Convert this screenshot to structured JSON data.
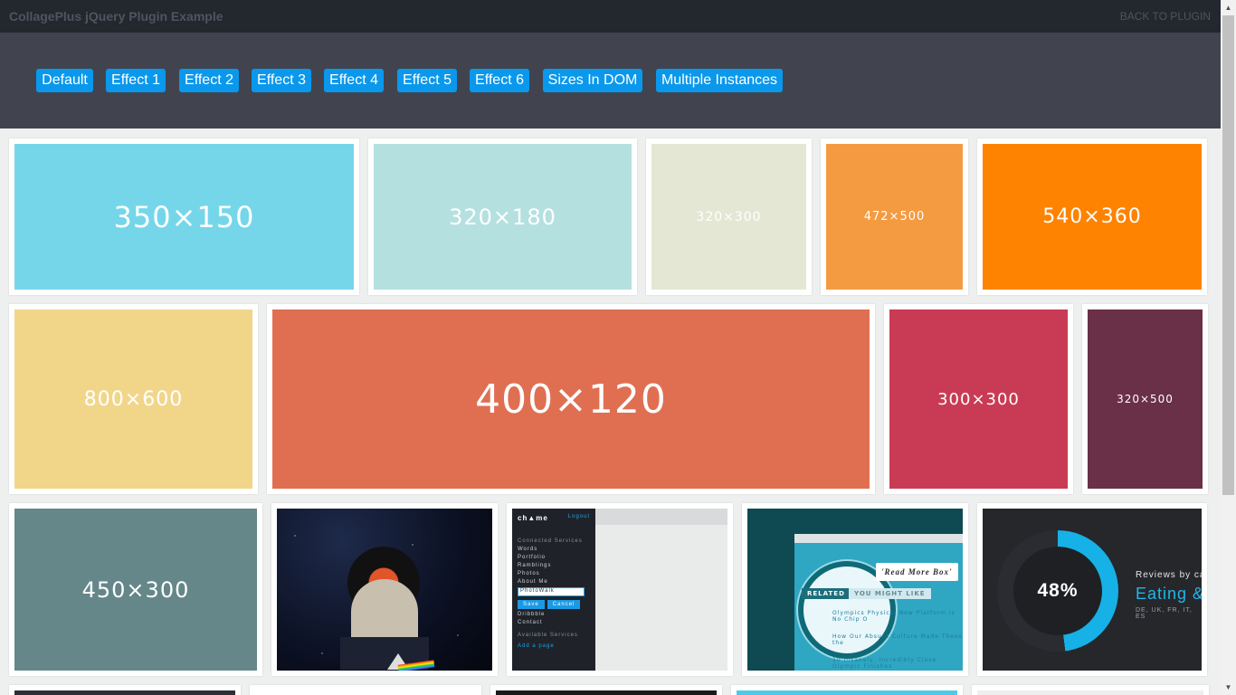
{
  "header": {
    "title": "CollagePlus jQuery Plugin Example",
    "back_link": "BACK TO PLUGIN"
  },
  "toolbar": {
    "buttons": [
      "Default",
      "Effect 1",
      "Effect 2",
      "Effect 3",
      "Effect 4",
      "Effect 5",
      "Effect 6",
      "Sizes In DOM",
      "Multiple Instances"
    ]
  },
  "placeholders": [
    {
      "label": "350×150",
      "color": "#75d6ea"
    },
    {
      "label": "320×180",
      "color": "#b5e0e0"
    },
    {
      "label": "320×300",
      "color": "#e4e7d3"
    },
    {
      "label": "472×500",
      "color": "#f49b41"
    },
    {
      "label": "540×360",
      "color": "#fe8301"
    },
    {
      "label": "800×600",
      "color": "#f1d68a"
    },
    {
      "label": "400×120",
      "color": "#e06f52"
    },
    {
      "label": "300×300",
      "color": "#c93b54"
    },
    {
      "label": "320×500",
      "color": "#6a3047"
    },
    {
      "label": "450×300",
      "color": "#658789"
    }
  ],
  "app_screenshot": {
    "logo": "ch▲me",
    "logout": "Logout",
    "section_connected": "Connected Services",
    "items": [
      "Words",
      "Portfolio",
      "Ramblings",
      "Photos",
      "About Me"
    ],
    "field_value": "PhotoWalk",
    "save": "Save",
    "cancel": "Cancel",
    "items_after": [
      "Dribbble",
      "Contact"
    ],
    "section_available": "Available Services",
    "add_page": "Add a page"
  },
  "magnify_screenshot": {
    "tab_related": "RELATED",
    "tab_might": "YOU MIGHT LIKE",
    "readmore": "'Read More Box'",
    "lines": [
      "Olympics Physics: New Platform Is No Chip O",
      "How Our Absurd Culture Made These the",
      "10 Insanely, Incredibly Close Olympic Finishes"
    ]
  },
  "stat_screenshot": {
    "percent": "48%",
    "caption": "Reviews by cate",
    "headline": "Eating &",
    "sub": "DE, UK, FR, IT, ES"
  }
}
